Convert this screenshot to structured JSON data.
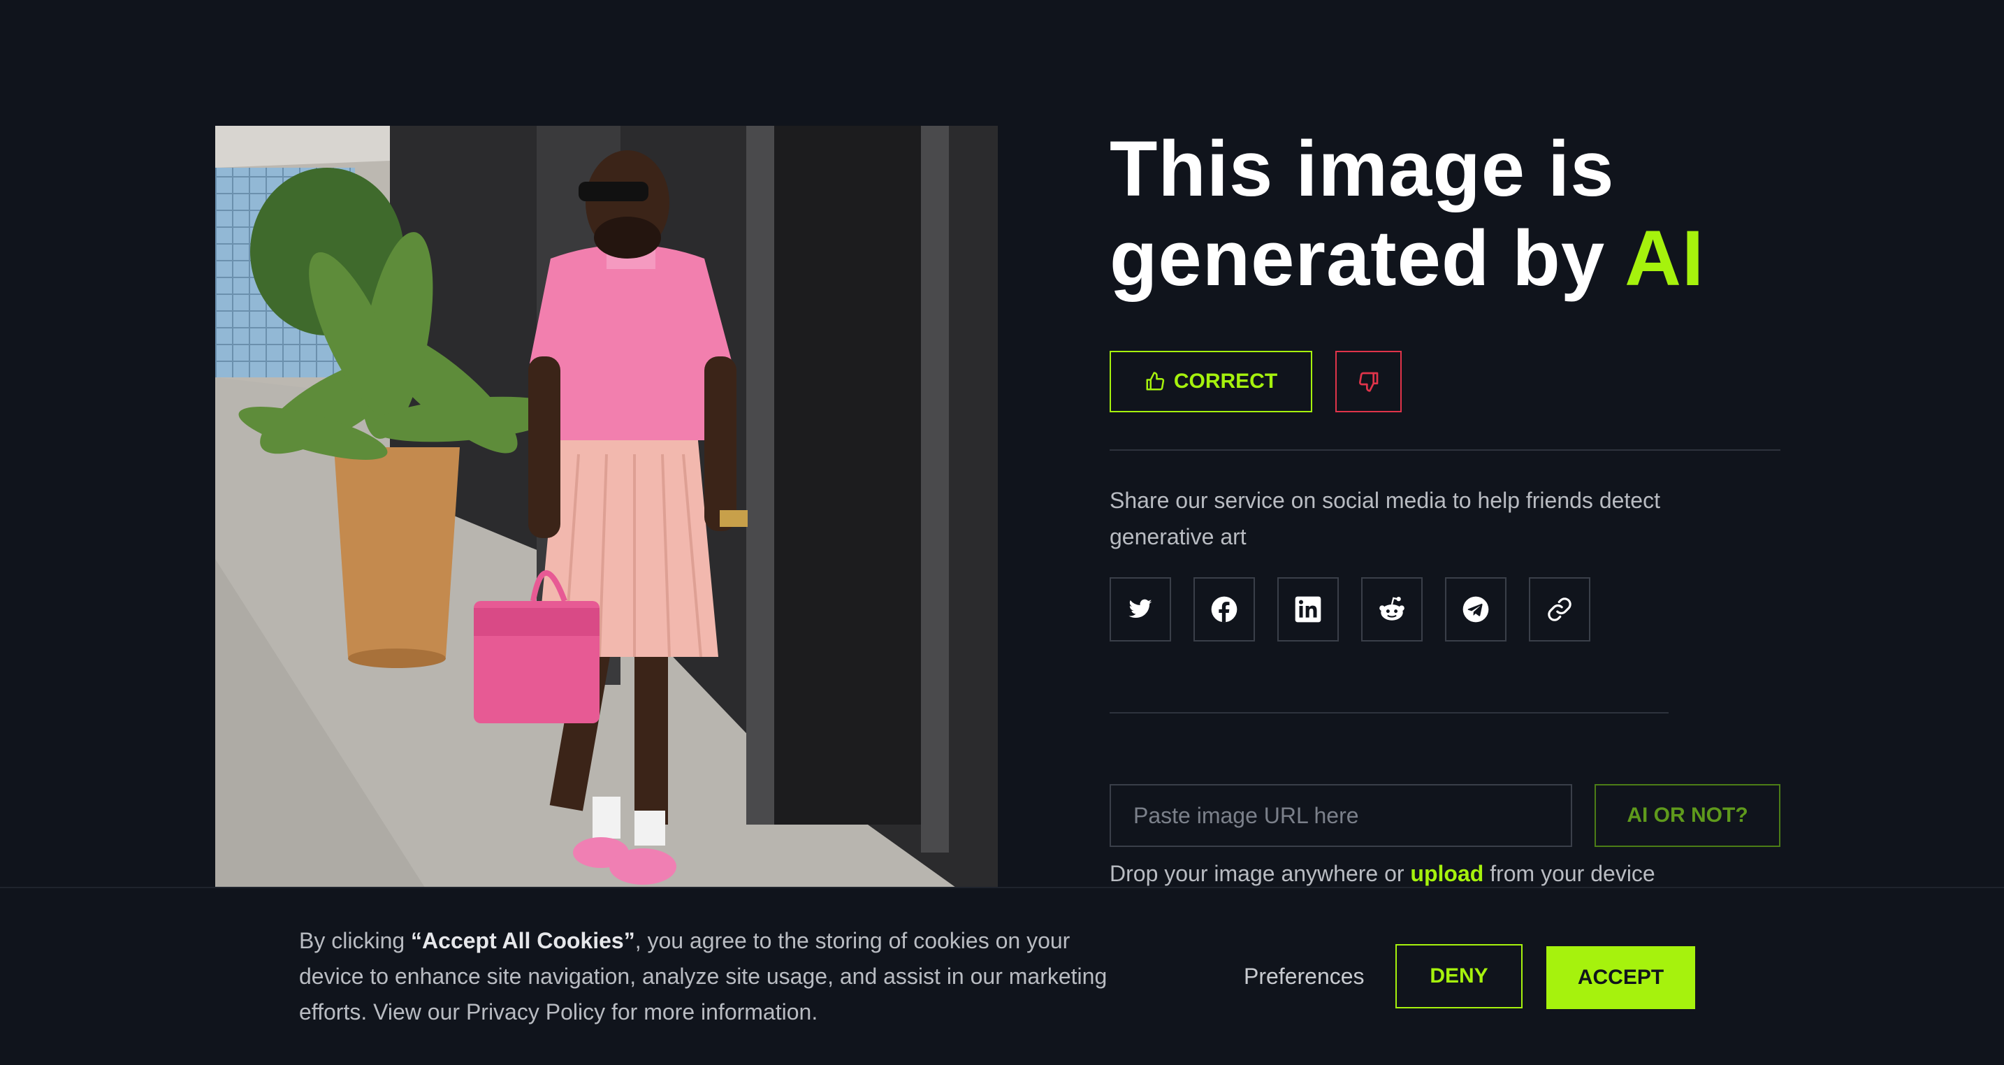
{
  "result": {
    "headline_prefix": "This image is generated by",
    "headline_accent": "AI"
  },
  "feedback": {
    "correct_label": "CORRECT"
  },
  "share": {
    "text": "Share our service on social media to help friends detect generative art",
    "buttons": [
      {
        "icon": "twitter-icon"
      },
      {
        "icon": "facebook-icon"
      },
      {
        "icon": "linkedin-icon"
      },
      {
        "icon": "reddit-icon"
      },
      {
        "icon": "telegram-icon"
      },
      {
        "icon": "link-icon"
      }
    ]
  },
  "checker": {
    "url_placeholder": "Paste image URL here",
    "url_value": "",
    "submit_label": "AI OR NOT?",
    "drop_prefix": "Drop your image anywhere or",
    "upload_link": "upload",
    "drop_suffix": "from your device"
  },
  "cookie_banner": {
    "text_prefix": "By clicking",
    "text_bold": "“Accept All Cookies”",
    "text_suffix": ", you agree to the storing of cookies on your device to enhance site navigation, analyze site usage, and assist in our marketing efforts. View our Privacy Policy for more information.",
    "preferences_label": "Preferences",
    "deny_label": "DENY",
    "accept_label": "ACCEPT"
  },
  "colors": {
    "background": "#10141c",
    "accent": "#a6f20d",
    "negative": "#e0344a"
  }
}
